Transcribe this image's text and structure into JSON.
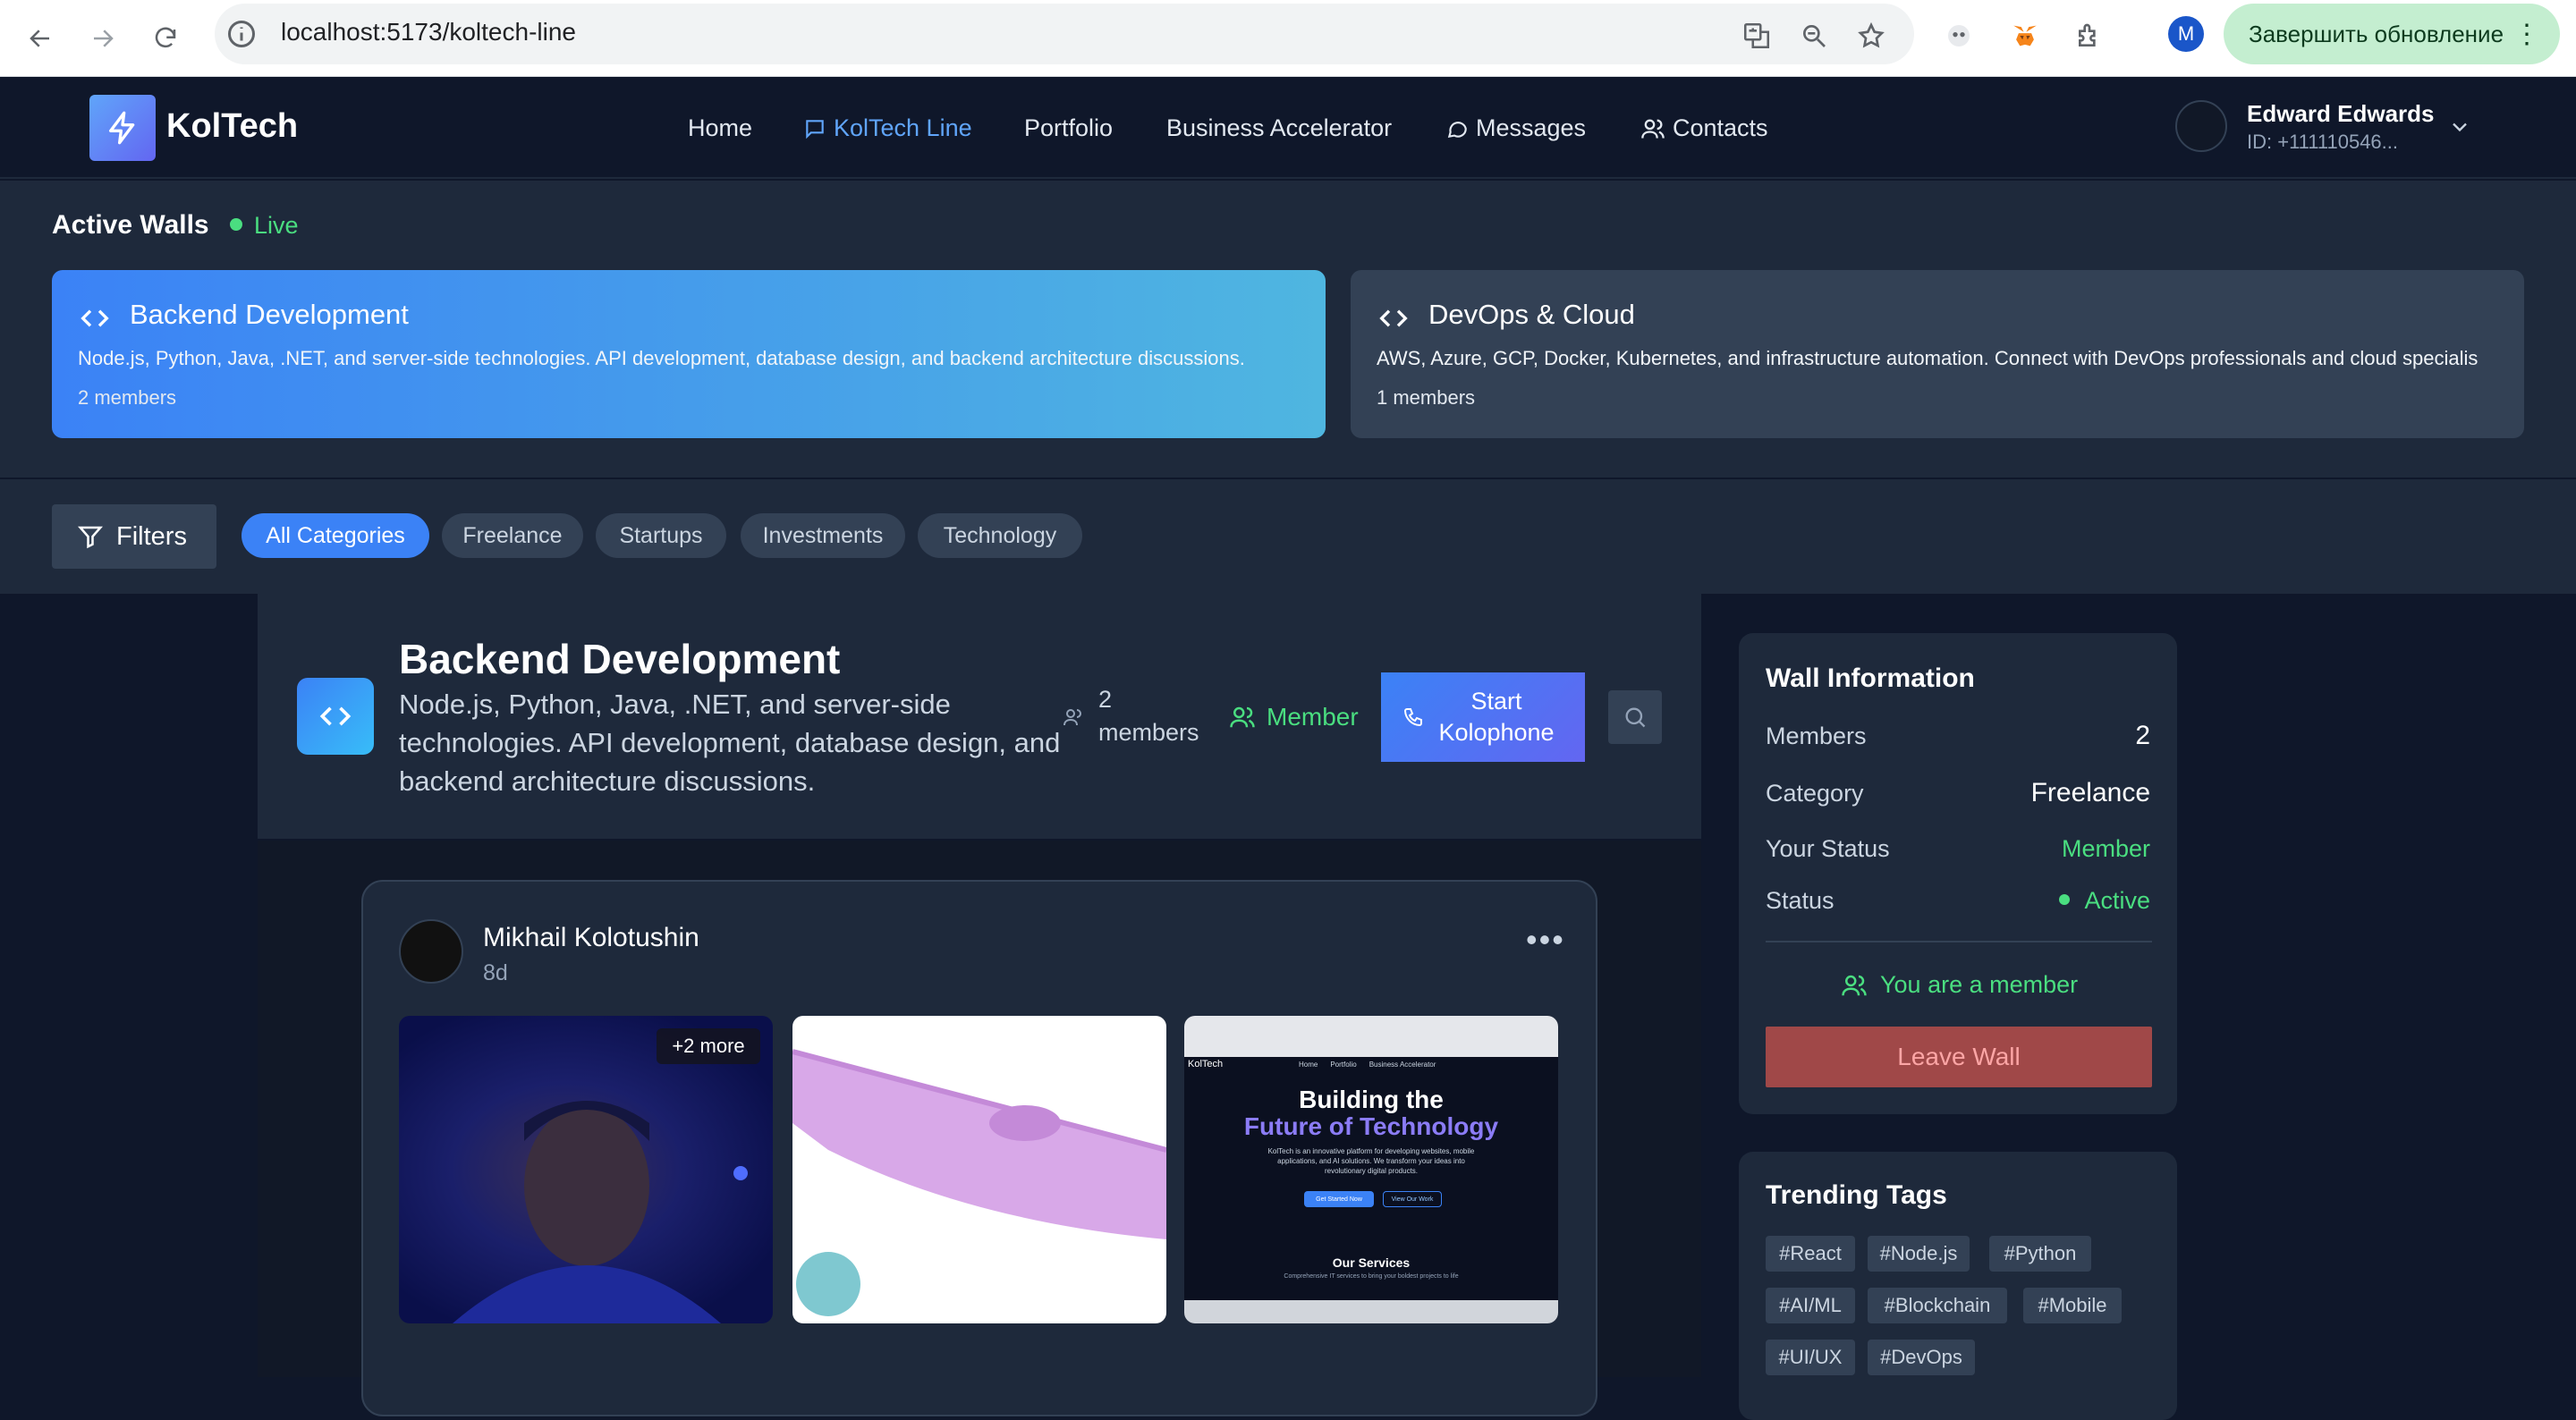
{
  "browser": {
    "url": "localhost:5173/koltech-line",
    "update_button_label": "Завершить обновление",
    "profile_initial": "M"
  },
  "header": {
    "brand": "KolTech",
    "nav": [
      "Home",
      "KolTech Line",
      "Portfolio",
      "Business Accelerator",
      "Messages",
      "Contacts"
    ],
    "active_nav": "KolTech Line",
    "user": {
      "name": "Edward Edwards",
      "id": "ID: +111110546..."
    }
  },
  "active_walls": {
    "title": "Active Walls",
    "live_label": "Live",
    "walls": [
      {
        "name": "Backend Development",
        "description": "Node.js, Python, Java, .NET, and server-side technologies. API development, database design, and backend architecture discussions.",
        "members": "2 members"
      },
      {
        "name": "DevOps & Cloud",
        "description": "AWS, Azure, GCP, Docker, Kubernetes, and infrastructure automation. Connect with DevOps professionals and cloud specialis",
        "members": "1 members"
      }
    ]
  },
  "filters": {
    "button_label": "Filters",
    "categories": [
      "All Categories",
      "Freelance",
      "Startups",
      "Investments",
      "Technology"
    ],
    "selected": "All Categories"
  },
  "wall_header": {
    "title": "Backend Development",
    "description": "Node.js, Python, Java, .NET, and server-side technologies. API development, database design, and backend architecture discussions.",
    "members_line1": "2",
    "members_line2": "members",
    "member_badge": "Member",
    "start_line1": "Start",
    "start_line2": "Kolophone"
  },
  "post": {
    "author": "Mikhail Kolotushin",
    "time": "8d",
    "more_images_label": "+2 more",
    "image3": {
      "heading1": "Building the",
      "heading2": "Future of Technology",
      "body": "KolTech is an innovative platform for developing websites, mobile applications, and AI solutions. We transform your ideas into revolutionary digital products.",
      "btn1": "Get Started Now",
      "btn2": "View Our Work",
      "services_title": "Our Services",
      "services_sub": "Comprehensive IT services to bring your boldest projects to life",
      "nav": [
        "Home",
        "Portfolio",
        "Business Accelerator"
      ],
      "brand": "KolTech"
    }
  },
  "wall_info": {
    "title": "Wall Information",
    "rows": [
      {
        "label": "Members",
        "value": "2"
      },
      {
        "label": "Category",
        "value": "Freelance"
      },
      {
        "label": "Your Status",
        "value": "Member"
      },
      {
        "label": "Status",
        "value": "Active"
      }
    ],
    "member_note": "You are a member",
    "leave_label": "Leave Wall"
  },
  "trending": {
    "title": "Trending Tags",
    "tags": [
      "#React",
      "#Node.js",
      "#Python",
      "#AI/ML",
      "#Blockchain",
      "#Mobile",
      "#UI/UX",
      "#DevOps"
    ]
  },
  "colors": {
    "accent": "#3b82f6",
    "live": "#4ade80",
    "leave": "#a04848",
    "bg": "#0f172a",
    "panel": "#1e293b"
  }
}
